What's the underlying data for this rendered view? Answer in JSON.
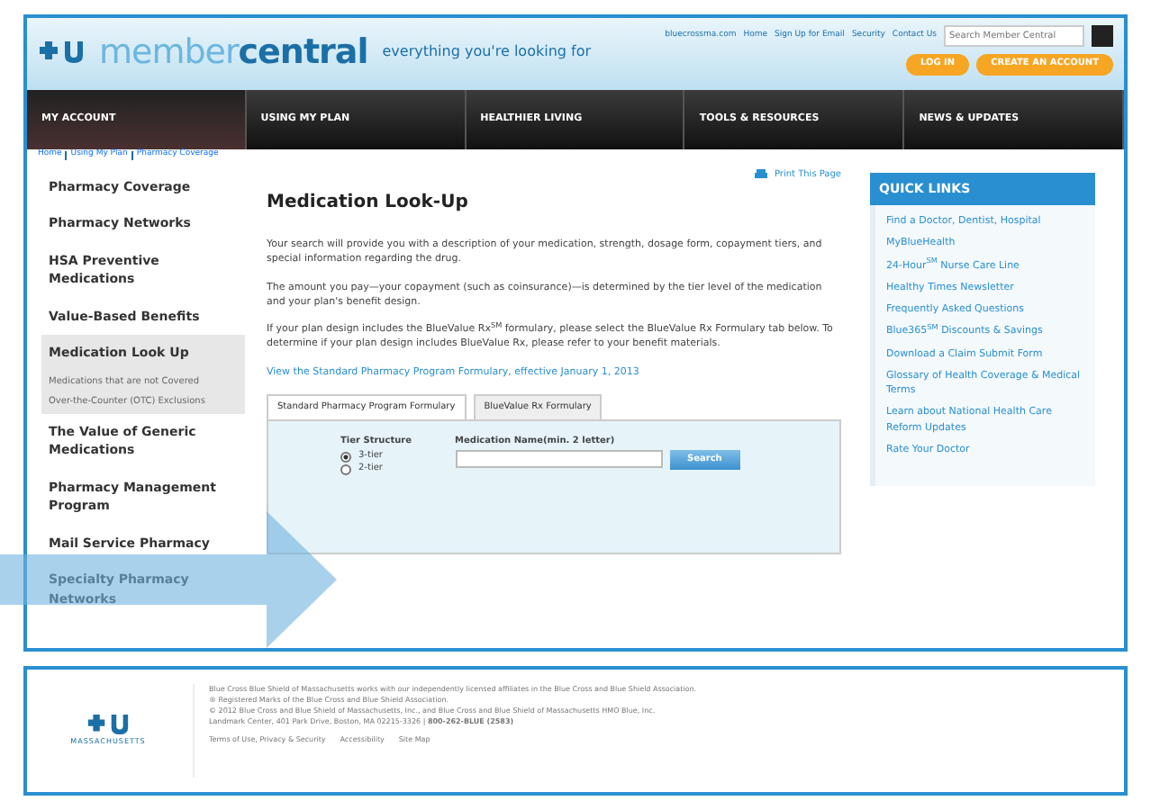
{
  "header": {
    "logo_text_light": "member",
    "logo_text_bold": "central",
    "tagline": "everything you're looking for",
    "top_links": [
      "bluecrossma.com",
      "Home",
      "Sign Up for Email",
      "Security",
      "Contact Us"
    ],
    "search": {
      "placeholder": "Search Member Central"
    },
    "buttons": [
      "LOG IN",
      "CREATE AN ACCOUNT"
    ]
  },
  "nav": [
    {
      "label": "MY ACCOUNT",
      "selected": true
    },
    {
      "label": "USING MY PLAN",
      "selected": false
    },
    {
      "label": "HEALTHIER LIVING",
      "selected": false
    },
    {
      "label": "TOOLS & RESOURCES",
      "selected": false
    },
    {
      "label": "NEWS & UPDATES",
      "selected": false
    }
  ],
  "breadcrumb": [
    "Home",
    "Using My Plan",
    "Pharmacy Coverage"
  ],
  "sidebar": {
    "items": [
      {
        "label": "Pharmacy Coverage",
        "selected": false
      },
      {
        "label": "Pharmacy Networks",
        "selected": false
      },
      {
        "label": "HSA Preventive Medications",
        "selected": false
      },
      {
        "label": "Value-Based Benefits",
        "selected": false
      },
      {
        "label": "Medication Look Up",
        "selected": true,
        "children": [
          {
            "label": "Medications that are not Covered"
          },
          {
            "label": "Over-the-Counter (OTC) Exclusions"
          }
        ]
      },
      {
        "label": "The Value of Generic Medications",
        "selected": false
      },
      {
        "label": "Pharmacy Management Program",
        "selected": false
      },
      {
        "label": "Mail Service Pharmacy",
        "selected": false
      },
      {
        "label": "Specialty Pharmacy Networks",
        "selected": false
      }
    ]
  },
  "main": {
    "print_link": "Print This Page",
    "title": "Medication Look-Up",
    "paragraphs": [
      "Your search will provide you with a description of your medication, strength, dosage form, copayment tiers, and special information regarding the drug.",
      "The amount you pay—your copayment (such as coinsurance)—is determined by the tier level of the medication and your plan's benefit design.",
      "If your plan design includes the BlueValue Rx$^{SM}$ formulary, please select the BlueValue Rx Formulary tab below. To determine if your plan design includes BlueValue Rx, please refer to your benefit materials."
    ],
    "formulary_link": "View the Standard Pharmacy Program Formulary, effective January 1, 2013",
    "tabs": [
      {
        "label": "Standard Pharmacy Program Formulary",
        "selected": true
      },
      {
        "label": "BlueValue Rx Formulary",
        "selected": false
      }
    ],
    "tier_label": "Tier Structure",
    "tiers": [
      {
        "label": "3-tier",
        "selected": true
      },
      {
        "label": "2-tier",
        "selected": false
      }
    ],
    "medication_label": "Medication Name(min. 2 letter)",
    "search_button": "Search"
  },
  "quick_links": {
    "title": "QUICK LINKS",
    "items": [
      "Find a Doctor, Dentist, Hospital",
      "MyBlueHealth",
      "24-Hour$^{SM}$ Nurse Care Line",
      "Healthy Times Newsletter",
      "Frequently Asked Questions",
      "Blue365$^{SM}$ Discounts & Savings",
      "Download a Claim Submit Form",
      "Glossary of Health Coverage & Medical Terms",
      "Learn about National Health Care Reform Updates",
      "Rate Your Doctor"
    ]
  },
  "footer": {
    "logo_caption": "MASSACHUSETTS",
    "lines": [
      "Blue Cross Blue Shield of Massachusetts works with our independently licensed affiliates in the Blue Cross and Blue Shield Association.",
      "® Registered Marks of the Blue Cross and Blue Shield Association.",
      "© 2012 Blue Cross and Blue Shield of Massachusetts, Inc., and Blue Cross and Blue Shield of Massachusetts HMO Blue, Inc.",
      "Landmark Center, 401 Park Drive, Boston, MA 02215-3326 | **800-262-BLUE (2583)**"
    ],
    "links": [
      "Terms of Use, Privacy & Security",
      "Accessibility",
      "Site Map"
    ]
  }
}
